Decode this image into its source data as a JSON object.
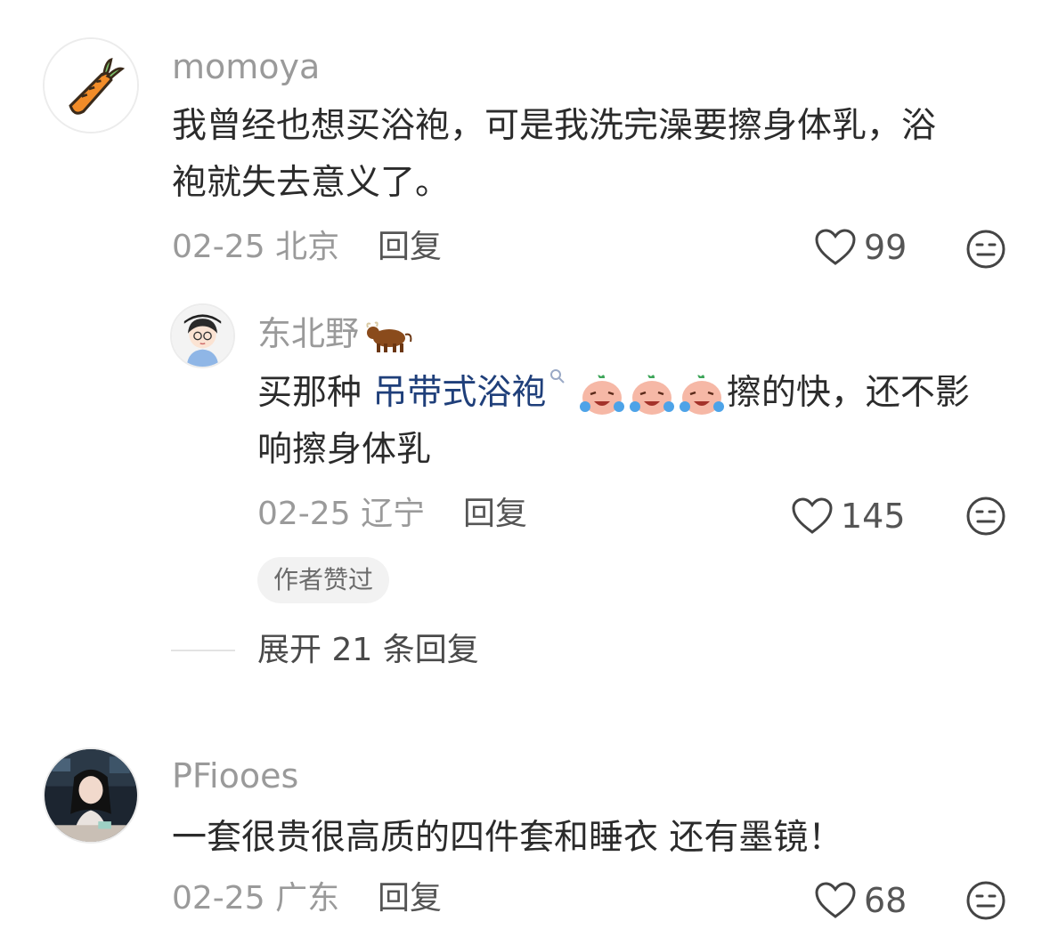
{
  "comments": [
    {
      "username": "momoya",
      "text_line1": "我曾经也想买浴袍，可是我洗完澡要擦身体乳，浴",
      "text_line2": "袍就失去意义了。",
      "date": "02-25",
      "location": "北京",
      "reply_label": "回复",
      "likes": "99",
      "avatar_icon": "carrot-icon"
    },
    {
      "username": "东北野",
      "username_emoji": "ox-icon",
      "text_prefix": "买那种 ",
      "text_link": "吊带式浴袍",
      "text_suffix": "擦的快，还不影",
      "text_line2": "响擦身体乳",
      "date": "02-25",
      "location": "辽宁",
      "reply_label": "回复",
      "likes": "145",
      "author_badge": "作者赞过",
      "avatar_icon": "girl-cartoon-icon"
    },
    {
      "username": "PFiooes",
      "text_line1": "一套很贵很高质的四件套和睡衣 还有墨镜！",
      "date": "02-25",
      "location": "广东",
      "reply_label": "回复",
      "likes": "68",
      "avatar_icon": "photo-avatar-icon"
    }
  ],
  "expand_replies": "展开 21 条回复",
  "colors": {
    "username": "#9a9a9a",
    "text": "#2b2b2b",
    "link": "#1f3f7a",
    "badge_bg": "#f2f2f2"
  }
}
